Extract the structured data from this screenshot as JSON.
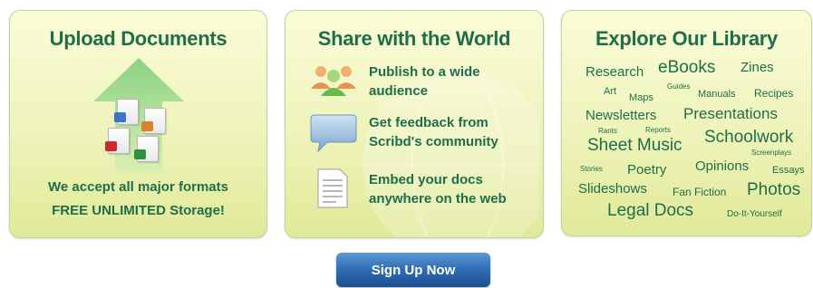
{
  "upload": {
    "title": "Upload Documents",
    "formats_text": "We accept all major formats",
    "storage_text": "FREE UNLIMITED Storage!"
  },
  "share": {
    "title": "Share with the World",
    "features": [
      {
        "line1": "Publish to a wide",
        "line2": "audience",
        "icon": "people-icon"
      },
      {
        "line1": "Get feedback from",
        "line2": "Scribd's community",
        "icon": "speech-bubble-icon"
      },
      {
        "line1": "Embed your docs",
        "line2": "anywhere on the web",
        "icon": "document-icon"
      }
    ]
  },
  "library": {
    "title": "Explore Our Library",
    "tags": [
      "Research",
      "eBooks",
      "Zines",
      "Art",
      "Maps",
      "Guides",
      "Manuals",
      "Recipes",
      "Newsletters",
      "Presentations",
      "Rants",
      "Reports",
      "Sheet Music",
      "Schoolwork",
      "Screenplays",
      "Stories",
      "Poetry",
      "Opinions",
      "Essays",
      "Slideshows",
      "Fan Fiction",
      "Photos",
      "Legal Docs",
      "Do-It-Yourself"
    ]
  },
  "cta": {
    "signup_label": "Sign Up Now"
  },
  "colors": {
    "accent_green": "#1f6e4b",
    "panel_bg": "#eef3b9",
    "button_blue": "#2e6cb4"
  }
}
